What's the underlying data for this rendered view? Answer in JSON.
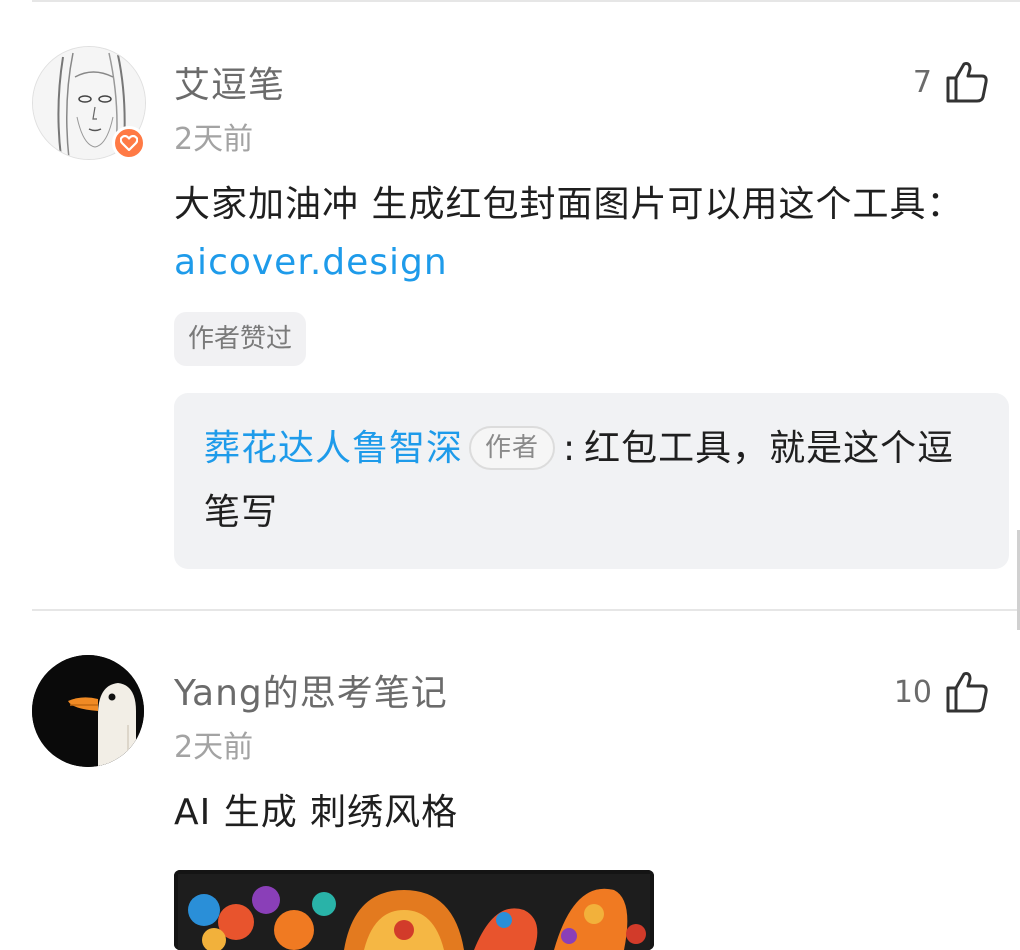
{
  "comments": [
    {
      "username": "艾逗笔",
      "time": "2天前",
      "likes": "7",
      "content_text": "大家加油冲 生成红包封面图片可以用这个工具：",
      "content_link": "aicover.design",
      "tag": "作者赞过",
      "reply": {
        "author": "葬花达人鲁智深",
        "author_tag": "作者",
        "separator": ":",
        "text": "红包工具，就是这个逗笔写"
      },
      "avatar_icon": "sketch-girl-avatar",
      "badge_icon": "heart-badge-icon"
    },
    {
      "username": "Yang的思考笔记",
      "time": "2天前",
      "likes": "10",
      "content_text": "AI 生成 刺绣风格",
      "avatar_icon": "goose-avatar",
      "image_icon": "embroidery-art-image"
    }
  ],
  "colors": {
    "link": "#1e9bea",
    "badge": "#ff7a45",
    "tag_bg": "#f1f1f3",
    "reply_bg": "#f1f2f4"
  }
}
